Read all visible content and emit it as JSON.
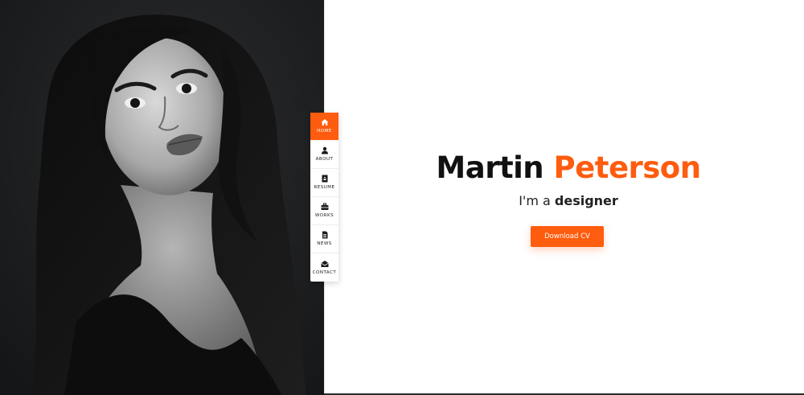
{
  "nav": {
    "items": [
      {
        "label": "HOME",
        "icon": "home-icon",
        "active": true
      },
      {
        "label": "ABOUT",
        "icon": "user-icon",
        "active": false
      },
      {
        "label": "RESUME",
        "icon": "resume-icon",
        "active": false
      },
      {
        "label": "WORKS",
        "icon": "briefcase-icon",
        "active": false
      },
      {
        "label": "NEWS",
        "icon": "news-icon",
        "active": false
      },
      {
        "label": "CONTACT",
        "icon": "envelope-icon",
        "active": false
      }
    ]
  },
  "hero": {
    "first_name": "Martin",
    "last_name": "Peterson",
    "subtitle_prefix": "I'm a",
    "subtitle_role": "designer",
    "cta_label": "Download CV"
  },
  "colors": {
    "accent": "#fe5c0e",
    "dark": "#111111",
    "photo_bg": "#1c1d1f"
  }
}
